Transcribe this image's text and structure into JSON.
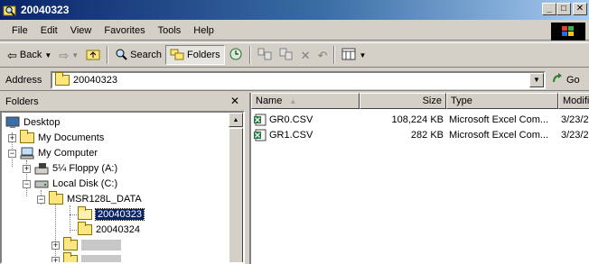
{
  "window": {
    "title": "20040323"
  },
  "menu": [
    "File",
    "Edit",
    "View",
    "Favorites",
    "Tools",
    "Help"
  ],
  "toolbar": {
    "back_label": "Back",
    "search_label": "Search",
    "folders_label": "Folders"
  },
  "address": {
    "label": "Address",
    "value": "20040323",
    "go_label": "Go"
  },
  "folders": {
    "header": "Folders",
    "close_glyph": "✕",
    "tree": {
      "desktop": "Desktop",
      "my_documents": "My Documents",
      "my_computer": "My Computer",
      "floppy": "5¼ Floppy (A:)",
      "local_disk": "Local Disk (C:)",
      "msr": "MSR128L_DATA",
      "selected": "20040323",
      "other": "20040324"
    }
  },
  "files": {
    "columns": {
      "name": "Name",
      "size": "Size",
      "type": "Type",
      "modified": "Modifie"
    },
    "rows": [
      {
        "name": "GR0.CSV",
        "size": "108,224 KB",
        "type": "Microsoft Excel Com...",
        "modified": "3/23/2"
      },
      {
        "name": "GR1.CSV",
        "size": "282 KB",
        "type": "Microsoft Excel Com...",
        "modified": "3/23/2"
      }
    ]
  }
}
